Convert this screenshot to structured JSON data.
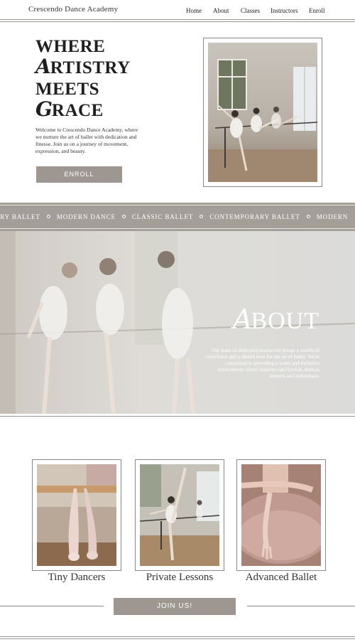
{
  "header": {
    "brand": "Crescendo Dance Academy",
    "nav": [
      "Home",
      "About",
      "Classes",
      "Instructors",
      "Enroll"
    ]
  },
  "hero": {
    "title_lines": [
      {
        "cap": "",
        "rest": "WHERE"
      },
      {
        "cap": "A",
        "rest": "RTISTRY"
      },
      {
        "cap": "",
        "rest": "MEETS"
      },
      {
        "cap": "G",
        "rest": "RACE"
      }
    ],
    "body": "Welcome to Crescendo Dance Academy, where we nurture the art of ballet with dedication and finesse. Join us on a journey of movement, expression, and beauty.",
    "button_label": "ENROLL"
  },
  "marquee": {
    "items": [
      "RARY BALLET",
      "MODERN DANCE",
      "CLASSIC BALLET",
      "CONTEMPORARY BALLET",
      "MODERN"
    ]
  },
  "about": {
    "title_cap": "A",
    "title_rest": "BOUT",
    "body": "Our team of dedicated instructors brings a wealth of experience and a shared love for the art of ballet. We're committed to providing a warm and inclusive environment where students can flourish, both as dancers and individuals."
  },
  "classes": {
    "items": [
      {
        "label": "Tiny Dancers",
        "icon": "pointe-shoes-photo"
      },
      {
        "label": "Private Lessons",
        "icon": "dancer-at-barre-photo"
      },
      {
        "label": "Advanced Ballet",
        "icon": "dancer-hands-tutu-photo"
      }
    ],
    "button_label": "JOIN US!"
  },
  "colors": {
    "accent": "#9e9791",
    "marquee_bg": "#a49e98",
    "frame_border": "#8c8782"
  }
}
